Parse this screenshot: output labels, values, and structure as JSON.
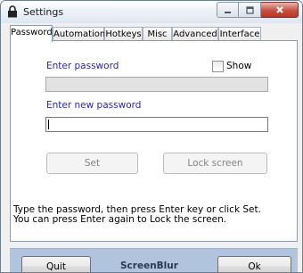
{
  "window": {
    "title": "Settings",
    "icon": "lock-icon",
    "controls": {
      "minimize": "minimize-icon",
      "maximize": "maximize-icon",
      "close": "close-icon"
    }
  },
  "tabs": [
    {
      "label": "Password",
      "active": true
    },
    {
      "label": "Automation",
      "active": false
    },
    {
      "label": "Hotkeys",
      "active": false
    },
    {
      "label": "Misc",
      "active": false
    },
    {
      "label": "Advanced",
      "active": false
    },
    {
      "label": "Interface",
      "active": false
    }
  ],
  "password_tab": {
    "enter_password_label": "Enter password",
    "show_label": "Show",
    "show_checked": false,
    "password_value": "",
    "new_password_label": "Enter new password",
    "new_password_value": "",
    "set_button": "Set",
    "lock_button": "Lock screen",
    "help_line1": "Type the password, then press Enter key or click Set.",
    "help_line2": "You can press Enter again to Lock the screen."
  },
  "footer": {
    "quit_button": "Quit",
    "brand": "ScreenBlur",
    "ok_button": "Ok"
  },
  "colors": {
    "label_blue": "#2323dc",
    "footer_bg": "#b0c4dd",
    "close_red": "#c7503f"
  }
}
